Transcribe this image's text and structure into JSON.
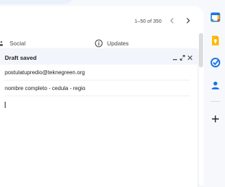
{
  "pager": {
    "range": "1–50 of 350"
  },
  "tabs": [
    {
      "label": "Social",
      "icon": "people-icon"
    },
    {
      "label": "Updates",
      "icon": "info-icon"
    }
  ],
  "compose": {
    "title": "Draft saved",
    "recipient": "postulatupredio@teknegreen.org",
    "subject": "nombre completo - cedula - regio",
    "body": ""
  },
  "side_rail": {
    "icons": [
      "calendar-icon",
      "keep-icon",
      "tasks-icon",
      "contacts-icon",
      "add-icon"
    ]
  },
  "colors": {
    "background": "#f6f8fc",
    "compose_header": "#f2f6fc",
    "calendar_blue": "#1a73e8",
    "keep_yellow": "#fbbc04",
    "tasks_blue": "#1a73e8",
    "contacts_blue": "#1a73e8"
  }
}
